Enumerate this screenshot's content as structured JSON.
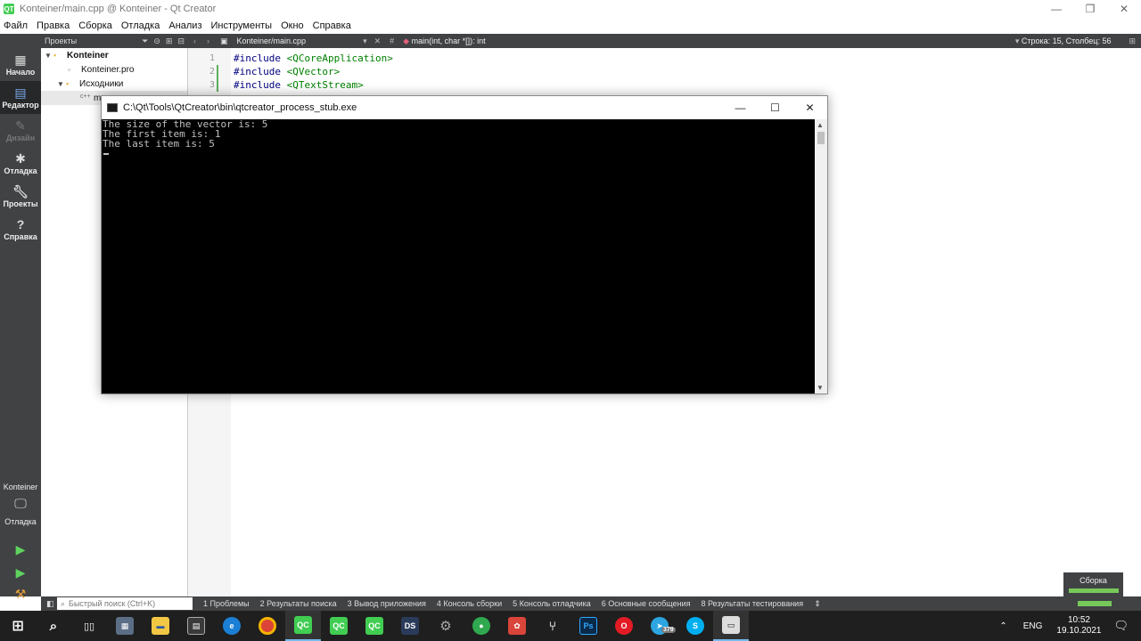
{
  "window": {
    "title": "Konteiner/main.cpp @ Konteiner - Qt Creator",
    "logo": "QT"
  },
  "menubar": [
    "Файл",
    "Правка",
    "Сборка",
    "Отладка",
    "Анализ",
    "Инструменты",
    "Окно",
    "Справка"
  ],
  "modes": [
    {
      "label": "Начало",
      "icon": "grid-icon"
    },
    {
      "label": "Редактор",
      "icon": "editor-icon"
    },
    {
      "label": "Дизайн",
      "icon": "pen-icon"
    },
    {
      "label": "Отладка",
      "icon": "bug-icon"
    },
    {
      "label": "Проекты",
      "icon": "wrench-icon"
    },
    {
      "label": "Справка",
      "icon": "help-icon"
    }
  ],
  "projects": {
    "header": "Проекты",
    "tree": {
      "project": "Konteiner",
      "pro_file": "Konteiner.pro",
      "sources": "Исходники",
      "source_file": "m"
    }
  },
  "editor": {
    "file": "Konteiner/main.cpp",
    "symbol": "main(int, char *[]): int",
    "position": "Строка: 15, Столбец: 56",
    "line_numbers": [
      "1",
      "2",
      "3"
    ],
    "lines": [
      {
        "kw": "#include",
        "inc": " <QCoreApplication>"
      },
      {
        "kw": "#include",
        "inc": " <QVector>"
      },
      {
        "kw": "#include",
        "inc": " <QTextStream>"
      }
    ]
  },
  "console": {
    "title": "C:\\Qt\\Tools\\QtCreator\\bin\\qtcreator_process_stub.exe",
    "lines": [
      "The size of the vector is: 5",
      "The first item is: 1",
      "The last item is: 5"
    ]
  },
  "kit": {
    "name": "Konteiner",
    "mode": "Отладка"
  },
  "statusbar": {
    "search_placeholder": "Быстрый поиск (Ctrl+K)",
    "tabs": [
      "1  Проблемы",
      "2  Результаты поиска",
      "3  Вывод приложения",
      "4  Консоль сборки",
      "5  Консоль отладчика",
      "6  Основные сообщения",
      "8  Результаты тестирования"
    ]
  },
  "build_widget": {
    "label": "Сборка"
  },
  "taskbar": {
    "lang": "ENG",
    "time": "10:52",
    "date": "19.10.2021",
    "telegram_badge": "379"
  },
  "colors": {
    "qt_green": "#41cd52",
    "sidebar": "#404244",
    "console_bg": "#000000",
    "console_text": "#c0c0c0"
  }
}
